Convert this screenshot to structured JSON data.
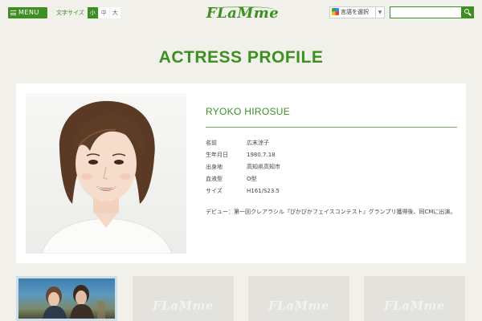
{
  "header": {
    "menu_label": "MENU",
    "font_size_caption": "文字サイズ",
    "font_size_options": [
      "小",
      "中",
      "大"
    ],
    "logo_text": "FLaMme",
    "translate_label": "言語を選択",
    "translate_caret": "▼",
    "search_placeholder": ""
  },
  "page_title": "ACTRESS PROFILE",
  "profile": {
    "name": "RYOKO HIROSUE",
    "facts": [
      {
        "label": "名前",
        "value": "広末涼子"
      },
      {
        "label": "生年月日",
        "value": "1980.7.18"
      },
      {
        "label": "出身地",
        "value": "高知県高知市"
      },
      {
        "label": "血液型",
        "value": "O型"
      },
      {
        "label": "サイズ",
        "value": "H161/S23.5"
      }
    ],
    "debut": "デビュー：第一回クレアラシル『ぴかぴかフェイスコンテスト』グランプリ獲得後、同CMに出演。"
  },
  "thumbnails": [
    {
      "placeholder": ""
    },
    {
      "placeholder": "FLaMme"
    },
    {
      "placeholder": "FLaMme"
    },
    {
      "placeholder": "FLaMme"
    }
  ],
  "colors": {
    "brand_green": "#3d8f22",
    "background": "#f1f0ea"
  }
}
